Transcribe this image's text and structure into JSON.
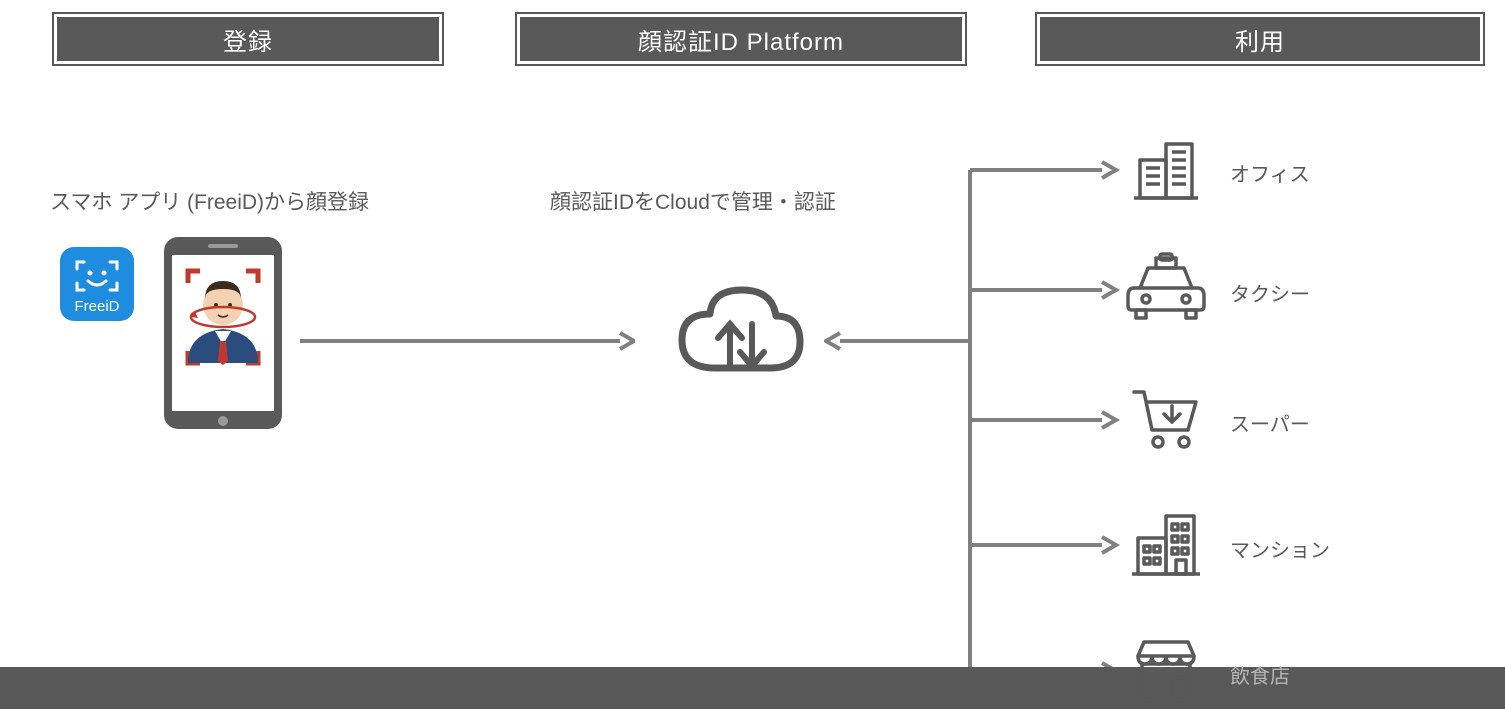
{
  "headers": {
    "register": "登録",
    "platform": "顔認証ID Platform",
    "use": "利用"
  },
  "subheadings": {
    "register": "スマホ アプリ (FreeiD)から顔登録",
    "platform": "顔認証IDをCloudで管理・認証"
  },
  "app_logo_label": "FreeiD",
  "use_cases": [
    {
      "icon": "office",
      "label": "オフィス"
    },
    {
      "icon": "taxi",
      "label": "タクシー"
    },
    {
      "icon": "supermarket",
      "label": "スーパー"
    },
    {
      "icon": "apartment",
      "label": "マンション"
    },
    {
      "icon": "restaurant",
      "label": "飲食店"
    }
  ],
  "colors": {
    "grey": "#595959",
    "line": "#808080",
    "logo_bg": "#1e8de0",
    "face_skin": "#f3d2b3",
    "suit": "#2b4d7e",
    "tie": "#c0392b",
    "hair": "#3a2b1e",
    "dim": "#b5b5b5"
  }
}
